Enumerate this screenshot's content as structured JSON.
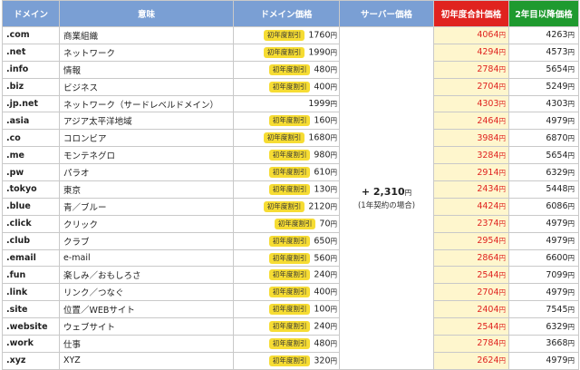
{
  "headers": {
    "domain": "ドメイン",
    "meaning": "意味",
    "domain_price": "ドメイン価格",
    "server_price": "サーバー価格",
    "first_year_total": "初年度合計価格",
    "second_year": "2年目以降価格"
  },
  "yen": "円",
  "badge_label": "初年度割引",
  "server": {
    "price": "+ 2,310",
    "yen": "円",
    "note": "(1年契約の場合)"
  },
  "colors": {
    "header_blue": "#7a9fd4",
    "header_red": "#e0231f",
    "header_green": "#1f9a2f",
    "first_year_bg": "#fef6cd",
    "first_year_text": "#e0231f",
    "badge_bg": "#f6dc33"
  },
  "rows": [
    {
      "domain": ".com",
      "meaning": "商業組織",
      "badge": true,
      "price": "1760",
      "first": "4064",
      "later": "4263"
    },
    {
      "domain": ".net",
      "meaning": "ネットワーク",
      "badge": true,
      "price": "1990",
      "first": "4294",
      "later": "4573"
    },
    {
      "domain": ".info",
      "meaning": "情報",
      "badge": true,
      "price": "480",
      "first": "2784",
      "later": "5654"
    },
    {
      "domain": ".biz",
      "meaning": "ビジネス",
      "badge": true,
      "price": "400",
      "first": "2704",
      "later": "5249"
    },
    {
      "domain": ".jp.net",
      "meaning": "ネットワーク（サードレベルドメイン）",
      "badge": false,
      "price": "1999",
      "first": "4303",
      "later": "4303"
    },
    {
      "domain": ".asia",
      "meaning": "アジア太平洋地域",
      "badge": true,
      "price": "160",
      "first": "2464",
      "later": "4979"
    },
    {
      "domain": ".co",
      "meaning": "コロンビア",
      "badge": true,
      "price": "1680",
      "first": "3984",
      "later": "6870"
    },
    {
      "domain": ".me",
      "meaning": "モンテネグロ",
      "badge": true,
      "price": "980",
      "first": "3284",
      "later": "5654"
    },
    {
      "domain": ".pw",
      "meaning": "パラオ",
      "badge": true,
      "price": "610",
      "first": "2914",
      "later": "6329"
    },
    {
      "domain": ".tokyo",
      "meaning": "東京",
      "badge": true,
      "price": "130",
      "first": "2434",
      "later": "5448"
    },
    {
      "domain": ".blue",
      "meaning": "青／ブルー",
      "badge": true,
      "price": "2120",
      "first": "4424",
      "later": "6086"
    },
    {
      "domain": ".click",
      "meaning": "クリック",
      "badge": true,
      "price": "70",
      "first": "2374",
      "later": "4979"
    },
    {
      "domain": ".club",
      "meaning": "クラブ",
      "badge": true,
      "price": "650",
      "first": "2954",
      "later": "4979"
    },
    {
      "domain": ".email",
      "meaning": "e-mail",
      "badge": true,
      "price": "560",
      "first": "2864",
      "later": "6600"
    },
    {
      "domain": ".fun",
      "meaning": "楽しみ／おもしろさ",
      "badge": true,
      "price": "240",
      "first": "2544",
      "later": "7099"
    },
    {
      "domain": ".link",
      "meaning": "リンク／つなぐ",
      "badge": true,
      "price": "400",
      "first": "2704",
      "later": "4979"
    },
    {
      "domain": ".site",
      "meaning": "位置／WEBサイト",
      "badge": true,
      "price": "100",
      "first": "2404",
      "later": "7545"
    },
    {
      "domain": ".website",
      "meaning": "ウェブサイト",
      "badge": true,
      "price": "240",
      "first": "2544",
      "later": "6329"
    },
    {
      "domain": ".work",
      "meaning": "仕事",
      "badge": true,
      "price": "480",
      "first": "2784",
      "later": "3668"
    },
    {
      "domain": ".xyz",
      "meaning": "XYZ",
      "badge": true,
      "price": "320",
      "first": "2624",
      "later": "4979"
    }
  ]
}
